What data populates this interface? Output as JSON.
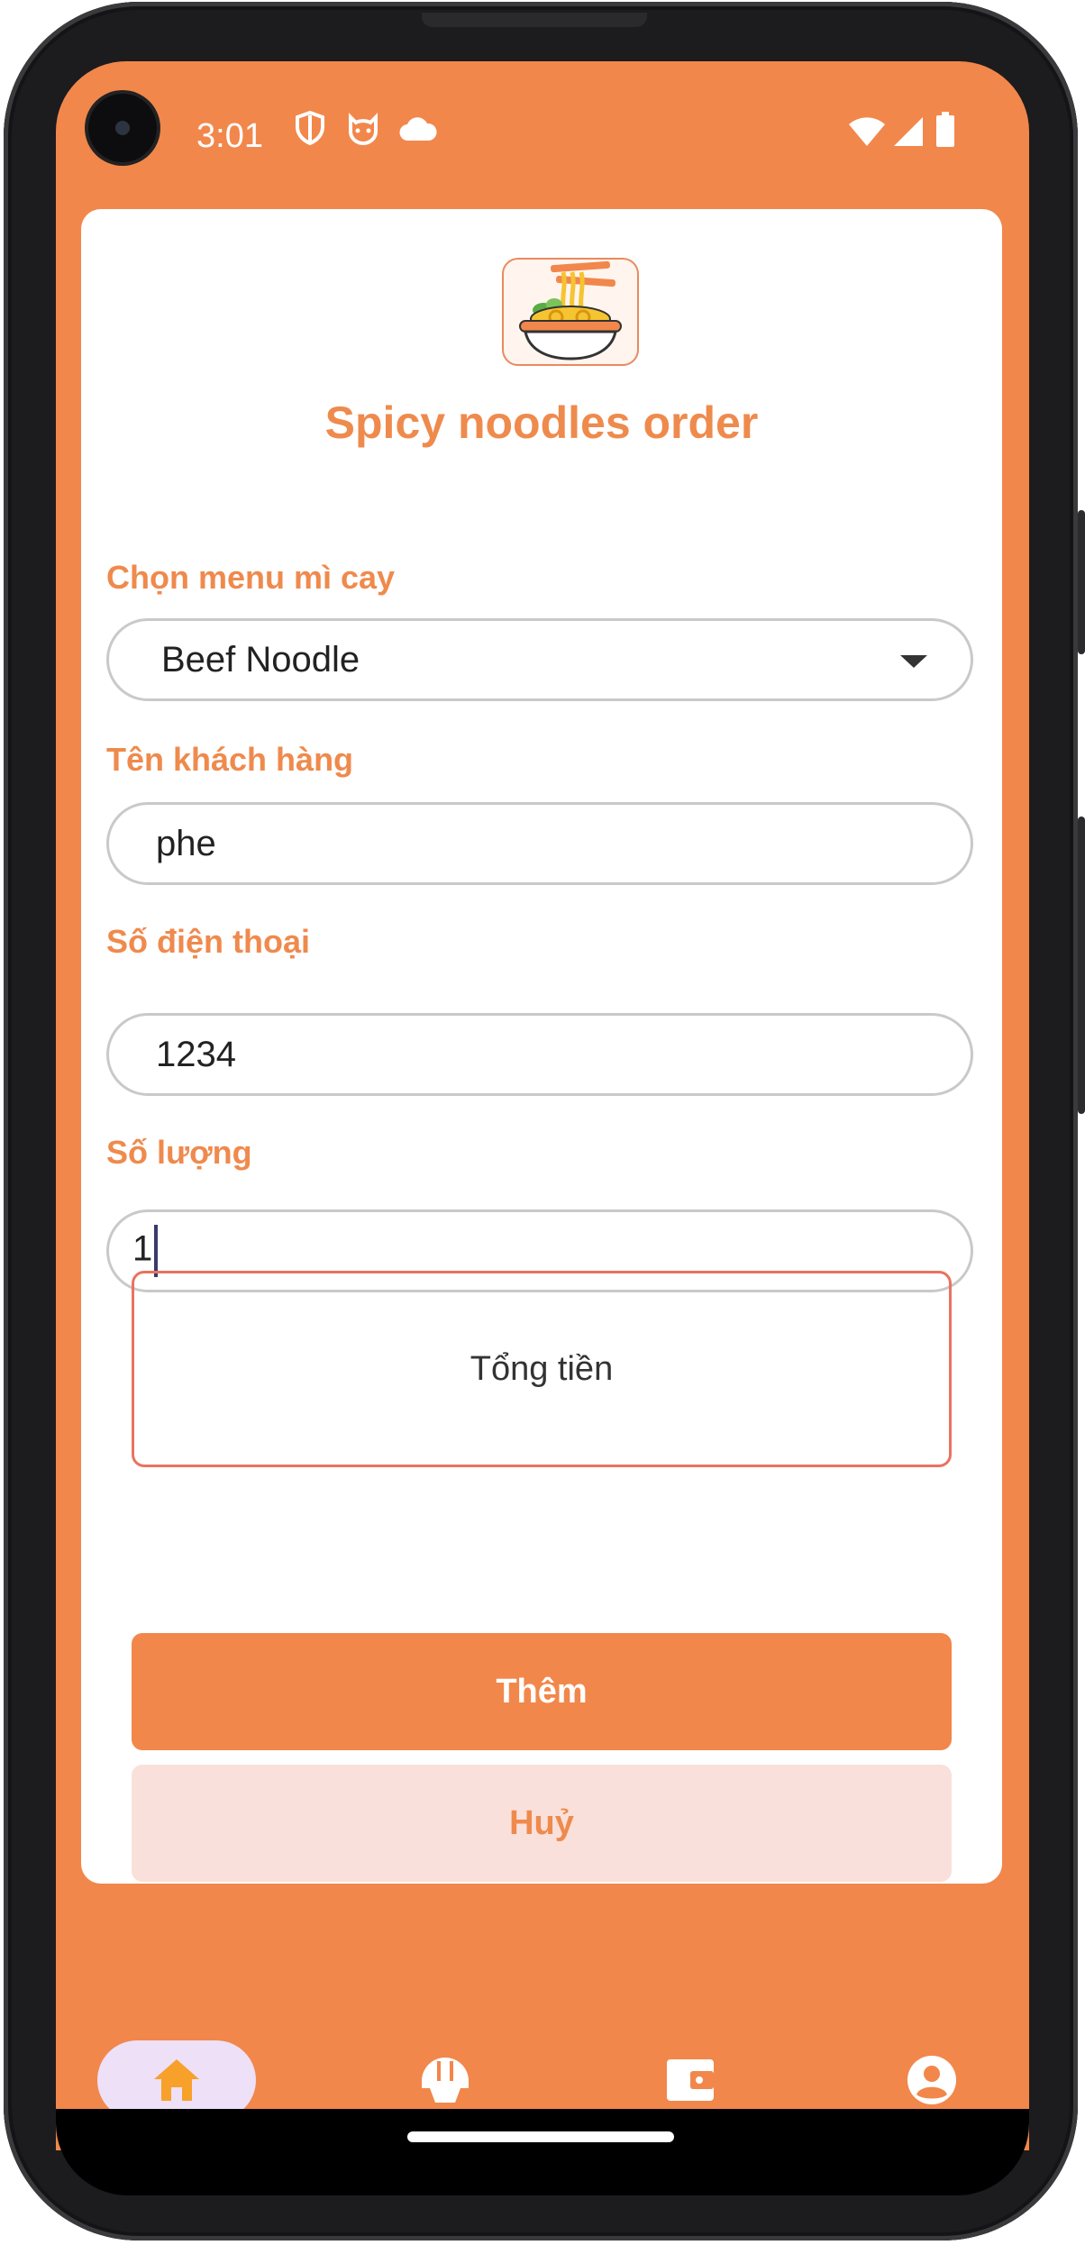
{
  "status_bar": {
    "time": "3:01",
    "icons": [
      "vpn-shield-icon",
      "cat-face-icon",
      "cloud-icon",
      "wifi-icon",
      "cell-signal-icon",
      "battery-icon"
    ]
  },
  "header": {
    "logo": "noodle-bowl-icon",
    "title": "Spicy noodles order"
  },
  "form": {
    "menu_label": "Chọn menu mì cay",
    "menu_selected": "Beef Noodle",
    "name_label": "Tên khách hàng",
    "name_value": "phe",
    "phone_label": "Số điện thoại",
    "phone_value": "1234",
    "quantity_label": "Số lượng",
    "quantity_value": "1"
  },
  "total": {
    "label": "Tổng tiền"
  },
  "buttons": {
    "add_label": "Thêm",
    "cancel_label": "Huỷ"
  },
  "bottom_nav": {
    "items": [
      {
        "icon": "home-icon",
        "active": true
      },
      {
        "icon": "rice-bowl-icon",
        "active": false
      },
      {
        "icon": "wallet-icon",
        "active": false
      },
      {
        "icon": "account-icon",
        "active": false
      }
    ]
  },
  "colors": {
    "accent": "#f2874b",
    "title_text": "#ef8a4d",
    "cancel_bg": "#fae0da",
    "active_nav_bg": "#ede0f7",
    "active_nav_icon": "#f7a12b"
  }
}
